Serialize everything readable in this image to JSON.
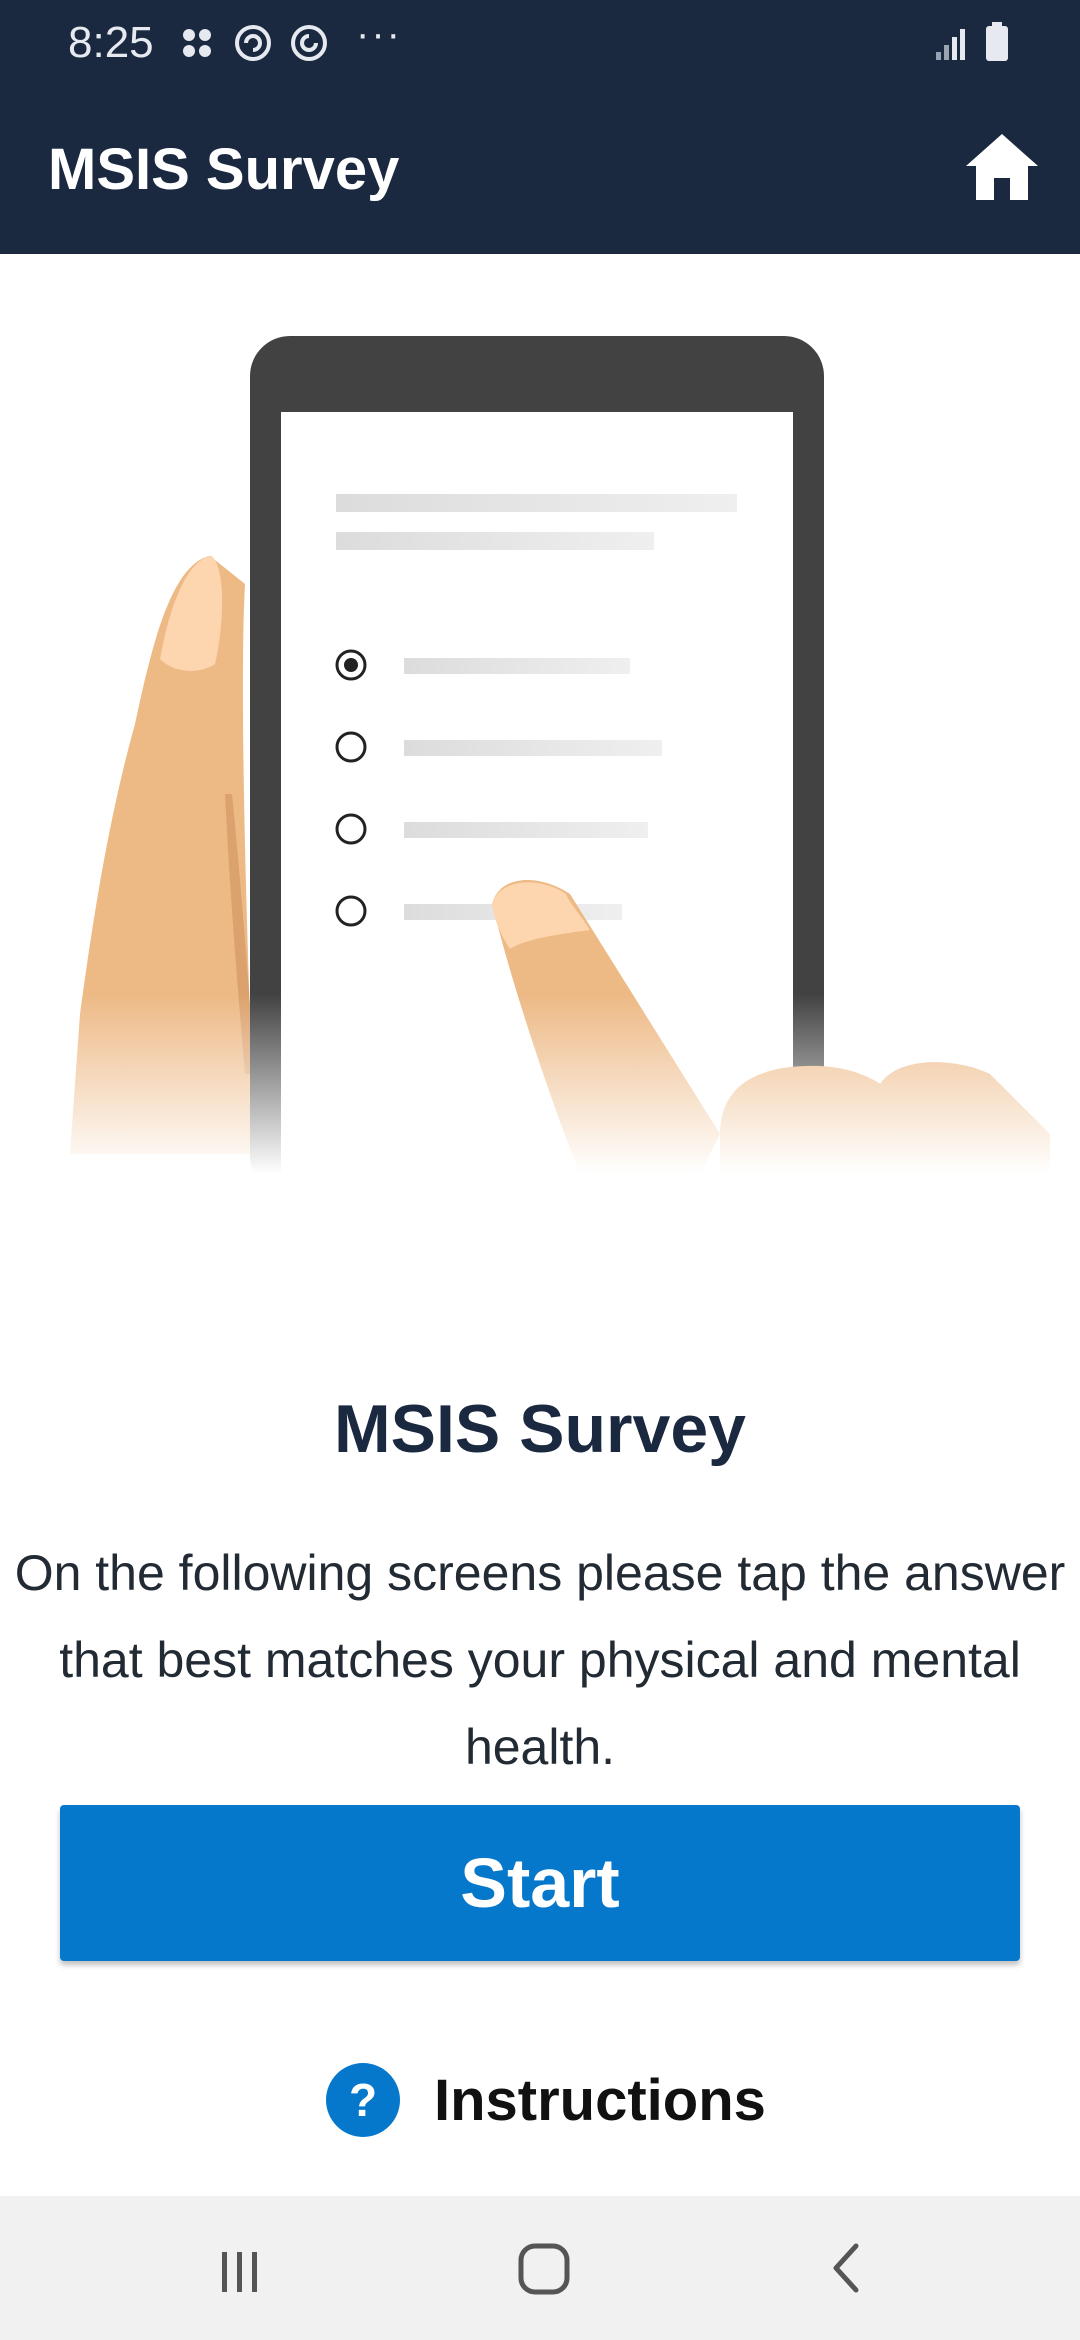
{
  "status_bar": {
    "time": "8:25",
    "more": "···",
    "icons": [
      "apps-icon",
      "sync-icon",
      "sync-alt-icon",
      "signal-icon",
      "battery-icon"
    ]
  },
  "app_bar": {
    "title": "MSIS Survey",
    "home_icon": "home-icon"
  },
  "illustration": {
    "description_icon": "survey-phone-illustration"
  },
  "main": {
    "title": "MSIS Survey",
    "description": "On the following screens please tap the answer that best matches your physical and mental health.",
    "start_label": "Start",
    "instructions_icon": "?",
    "instructions_label": "Instructions"
  },
  "nav_bar": {
    "icons": [
      "recent-apps-icon",
      "home-circle-icon",
      "back-icon"
    ]
  },
  "colors": {
    "header_bg": "#1b2940",
    "accent": "#0678cc",
    "nav_bg": "#f1f1f1"
  }
}
